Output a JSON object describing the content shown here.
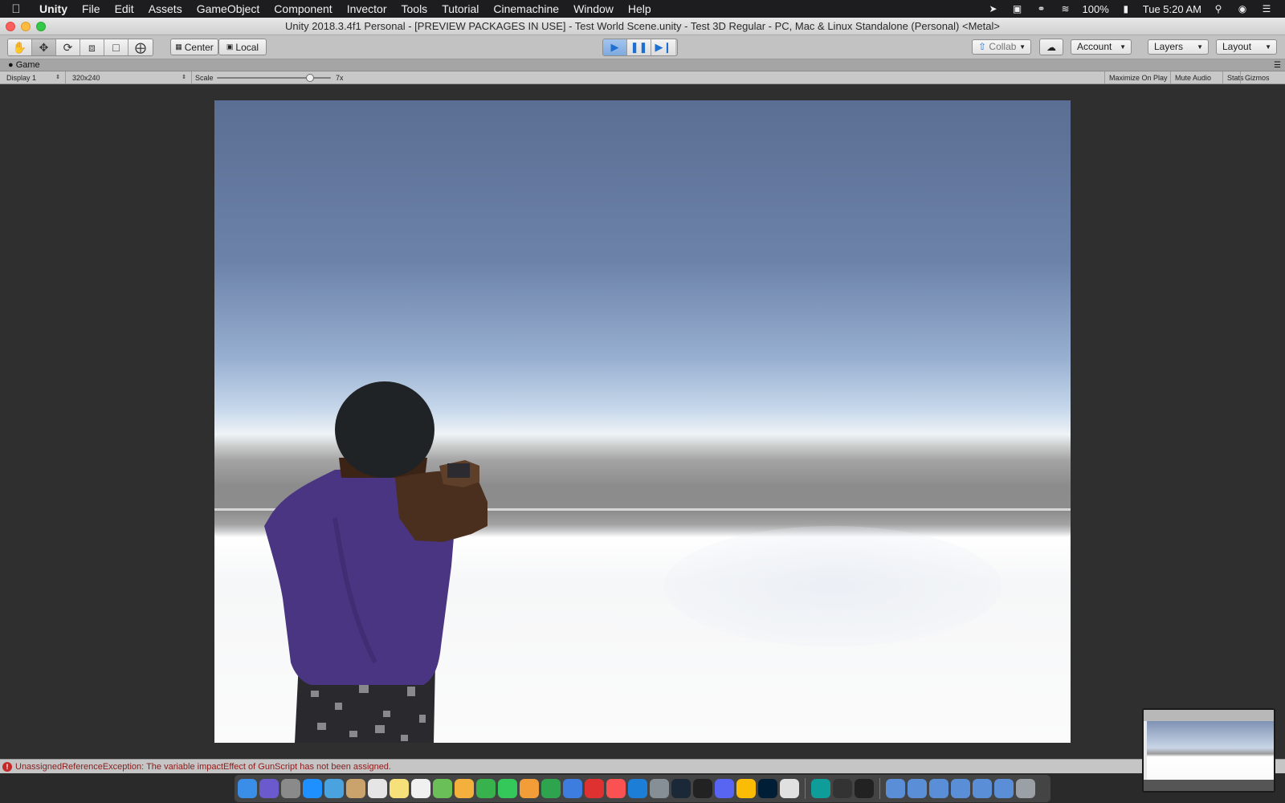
{
  "menubar": {
    "items": [
      "Unity",
      "File",
      "Edit",
      "Assets",
      "GameObject",
      "Component",
      "Invector",
      "Tools",
      "Tutorial",
      "Cinemachine",
      "Window",
      "Help"
    ],
    "battery": "100%",
    "clock": "Tue 5:20 AM"
  },
  "window": {
    "title": "Unity 2018.3.4f1 Personal - [PREVIEW PACKAGES IN USE] - Test World Scene.unity - Test 3D Regular - PC, Mac & Linux Standalone (Personal) <Metal>"
  },
  "toolbar": {
    "pivot_label": "Center",
    "space_label": "Local",
    "collab_label": "Collab",
    "account_label": "Account",
    "layers_label": "Layers",
    "layout_label": "Layout",
    "play_state": "playing"
  },
  "game_tab": {
    "label": "Game"
  },
  "game_bar": {
    "display": "Display 1",
    "resolution": "320x240",
    "scale_label": "Scale",
    "scale_value": "7x",
    "scale_fraction": 0.82,
    "maximize_label": "Maximize On Play",
    "mute_label": "Mute Audio",
    "stats_label": "Stats",
    "gizmos_label": "Gizmos"
  },
  "console": {
    "error": "UnassignedReferenceException: The variable impactEffect of GunScript has not been assigned."
  },
  "colors": {
    "play_accent": "#1e6fd0",
    "error": "#c62828",
    "shirt": "#4a3582",
    "skin": "#4b2f1e",
    "hair": "#1f2326"
  },
  "dock": {
    "icons": [
      "finder-icon",
      "siri-icon",
      "launchpad-icon",
      "safari-icon",
      "preview-icon",
      "notes-icon",
      "calendar-icon",
      "stickies-icon",
      "reminders-icon",
      "maps-icon",
      "photos-icon",
      "messages-icon",
      "facetime-icon",
      "pages-icon",
      "numbers-icon",
      "keynote-icon",
      "news-icon",
      "music-icon",
      "appstore-icon",
      "preferences-icon",
      "steam-icon",
      "zbrush-icon",
      "discord-icon",
      "chrome-icon",
      "photoshop-icon",
      "roblox-icon",
      "maya-icon",
      "unity-hub-icon",
      "unity-icon",
      "folder-icon",
      "folder-icon",
      "folder-icon",
      "folder-icon",
      "folder-icon",
      "folder-icon",
      "trash-icon"
    ]
  }
}
